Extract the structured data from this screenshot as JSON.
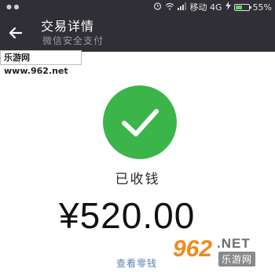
{
  "status_bar": {
    "carrier": "移动 4G",
    "battery": "55%",
    "battery_level": 0.55
  },
  "header": {
    "title": "交易详情",
    "subtitle": "微信安全支付"
  },
  "watermark_top": "乐游网 www.962.net",
  "transaction": {
    "status": "已收钱",
    "amount": "¥520.00",
    "view_change_link": "查看零钱"
  },
  "logo": {
    "number": "962",
    "suffix": ".NET",
    "name": "乐游网"
  },
  "colors": {
    "app_bar": "#2f2f35",
    "success": "#3bb54a",
    "link": "#5a7fb5"
  }
}
